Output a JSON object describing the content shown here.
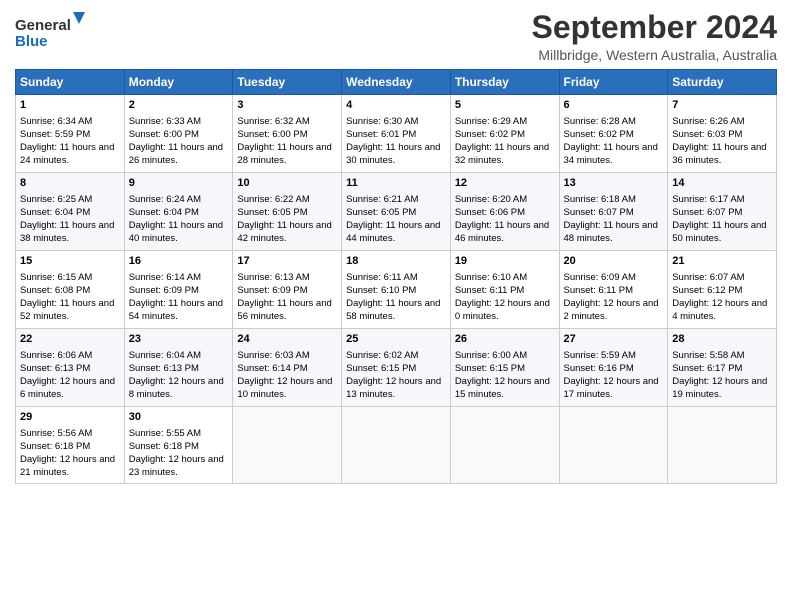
{
  "logo": {
    "line1": "General",
    "line2": "Blue"
  },
  "title": "September 2024",
  "location": "Millbridge, Western Australia, Australia",
  "headers": [
    "Sunday",
    "Monday",
    "Tuesday",
    "Wednesday",
    "Thursday",
    "Friday",
    "Saturday"
  ],
  "weeks": [
    [
      {
        "day": "1",
        "sunrise": "6:34 AM",
        "sunset": "5:59 PM",
        "daylight": "11 hours and 24 minutes."
      },
      {
        "day": "2",
        "sunrise": "6:33 AM",
        "sunset": "6:00 PM",
        "daylight": "11 hours and 26 minutes."
      },
      {
        "day": "3",
        "sunrise": "6:32 AM",
        "sunset": "6:00 PM",
        "daylight": "11 hours and 28 minutes."
      },
      {
        "day": "4",
        "sunrise": "6:30 AM",
        "sunset": "6:01 PM",
        "daylight": "11 hours and 30 minutes."
      },
      {
        "day": "5",
        "sunrise": "6:29 AM",
        "sunset": "6:02 PM",
        "daylight": "11 hours and 32 minutes."
      },
      {
        "day": "6",
        "sunrise": "6:28 AM",
        "sunset": "6:02 PM",
        "daylight": "11 hours and 34 minutes."
      },
      {
        "day": "7",
        "sunrise": "6:26 AM",
        "sunset": "6:03 PM",
        "daylight": "11 hours and 36 minutes."
      }
    ],
    [
      {
        "day": "8",
        "sunrise": "6:25 AM",
        "sunset": "6:04 PM",
        "daylight": "11 hours and 38 minutes."
      },
      {
        "day": "9",
        "sunrise": "6:24 AM",
        "sunset": "6:04 PM",
        "daylight": "11 hours and 40 minutes."
      },
      {
        "day": "10",
        "sunrise": "6:22 AM",
        "sunset": "6:05 PM",
        "daylight": "11 hours and 42 minutes."
      },
      {
        "day": "11",
        "sunrise": "6:21 AM",
        "sunset": "6:05 PM",
        "daylight": "11 hours and 44 minutes."
      },
      {
        "day": "12",
        "sunrise": "6:20 AM",
        "sunset": "6:06 PM",
        "daylight": "11 hours and 46 minutes."
      },
      {
        "day": "13",
        "sunrise": "6:18 AM",
        "sunset": "6:07 PM",
        "daylight": "11 hours and 48 minutes."
      },
      {
        "day": "14",
        "sunrise": "6:17 AM",
        "sunset": "6:07 PM",
        "daylight": "11 hours and 50 minutes."
      }
    ],
    [
      {
        "day": "15",
        "sunrise": "6:15 AM",
        "sunset": "6:08 PM",
        "daylight": "11 hours and 52 minutes."
      },
      {
        "day": "16",
        "sunrise": "6:14 AM",
        "sunset": "6:09 PM",
        "daylight": "11 hours and 54 minutes."
      },
      {
        "day": "17",
        "sunrise": "6:13 AM",
        "sunset": "6:09 PM",
        "daylight": "11 hours and 56 minutes."
      },
      {
        "day": "18",
        "sunrise": "6:11 AM",
        "sunset": "6:10 PM",
        "daylight": "11 hours and 58 minutes."
      },
      {
        "day": "19",
        "sunrise": "6:10 AM",
        "sunset": "6:11 PM",
        "daylight": "12 hours and 0 minutes."
      },
      {
        "day": "20",
        "sunrise": "6:09 AM",
        "sunset": "6:11 PM",
        "daylight": "12 hours and 2 minutes."
      },
      {
        "day": "21",
        "sunrise": "6:07 AM",
        "sunset": "6:12 PM",
        "daylight": "12 hours and 4 minutes."
      }
    ],
    [
      {
        "day": "22",
        "sunrise": "6:06 AM",
        "sunset": "6:13 PM",
        "daylight": "12 hours and 6 minutes."
      },
      {
        "day": "23",
        "sunrise": "6:04 AM",
        "sunset": "6:13 PM",
        "daylight": "12 hours and 8 minutes."
      },
      {
        "day": "24",
        "sunrise": "6:03 AM",
        "sunset": "6:14 PM",
        "daylight": "12 hours and 10 minutes."
      },
      {
        "day": "25",
        "sunrise": "6:02 AM",
        "sunset": "6:15 PM",
        "daylight": "12 hours and 13 minutes."
      },
      {
        "day": "26",
        "sunrise": "6:00 AM",
        "sunset": "6:15 PM",
        "daylight": "12 hours and 15 minutes."
      },
      {
        "day": "27",
        "sunrise": "5:59 AM",
        "sunset": "6:16 PM",
        "daylight": "12 hours and 17 minutes."
      },
      {
        "day": "28",
        "sunrise": "5:58 AM",
        "sunset": "6:17 PM",
        "daylight": "12 hours and 19 minutes."
      }
    ],
    [
      {
        "day": "29",
        "sunrise": "5:56 AM",
        "sunset": "6:18 PM",
        "daylight": "12 hours and 21 minutes."
      },
      {
        "day": "30",
        "sunrise": "5:55 AM",
        "sunset": "6:18 PM",
        "daylight": "12 hours and 23 minutes."
      },
      null,
      null,
      null,
      null,
      null
    ]
  ]
}
